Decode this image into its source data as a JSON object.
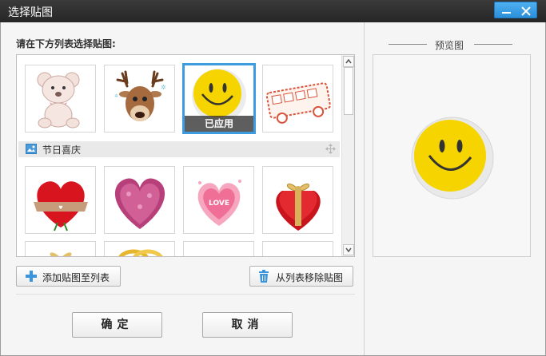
{
  "window": {
    "title": "选择贴图"
  },
  "list": {
    "instruction": "请在下方列表选择贴图:",
    "row1": [
      {
        "icon": "teddy-bear-sticker-icon"
      },
      {
        "icon": "reindeer-sticker-icon"
      },
      {
        "icon": "smiley-sticker-icon",
        "selected": true,
        "tag": "已应用"
      },
      {
        "icon": "bus-sticker-icon"
      }
    ],
    "category": {
      "label": "节日喜庆",
      "icon": "picture-icon"
    },
    "row2": [
      {
        "icon": "valentine-heart-sticker-icon"
      },
      {
        "icon": "flower-heart-sticker-icon"
      },
      {
        "icon": "love-heart-sticker-icon"
      },
      {
        "icon": "gift-box-sticker-icon"
      }
    ]
  },
  "buttons": {
    "add_label": "添加贴图至列表",
    "remove_label": "从列表移除贴图",
    "ok_label": "确定",
    "cancel_label": "取消"
  },
  "preview": {
    "title": "预览图"
  },
  "colors": {
    "accent": "#3d9be0",
    "titlebar": "#262626",
    "smiley_yellow": "#f5d400"
  }
}
